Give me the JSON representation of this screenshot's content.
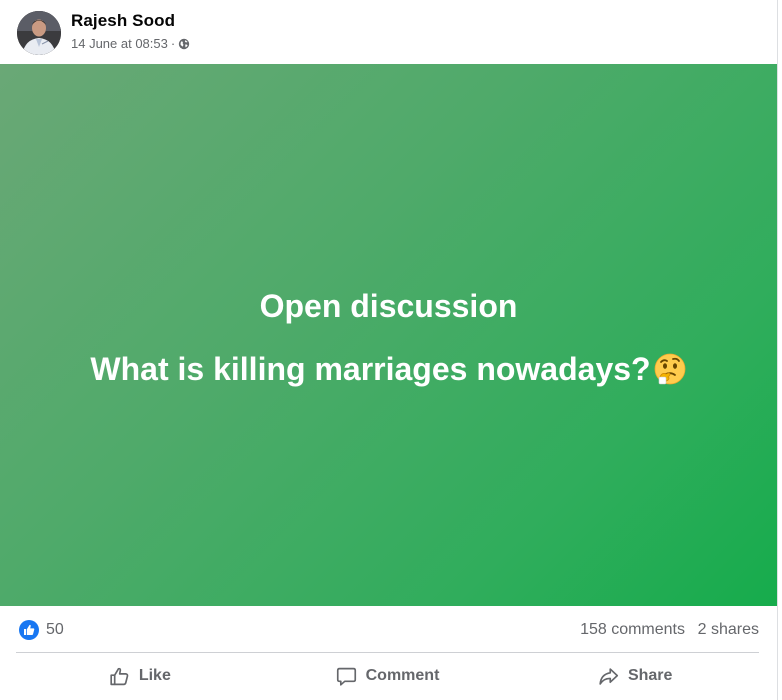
{
  "post": {
    "author": "Rajesh Sood",
    "timestamp": "14 June at 08:53",
    "separator": "·",
    "privacy_icon": "globe-icon",
    "card": {
      "line1": "Open discussion",
      "line2": "What is killing marriages nowadays?",
      "emoji": "thinking-face-emoji",
      "gradient_start": "#6aa876",
      "gradient_end": "#16ac4c"
    }
  },
  "stats": {
    "reactions": "50",
    "comments": "158 comments",
    "shares": "2 shares"
  },
  "actions": {
    "like": "Like",
    "comment": "Comment",
    "share": "Share"
  },
  "colors": {
    "brand_blue": "#1877f2",
    "secondary_text": "#65676b",
    "primary_text": "#050505"
  }
}
